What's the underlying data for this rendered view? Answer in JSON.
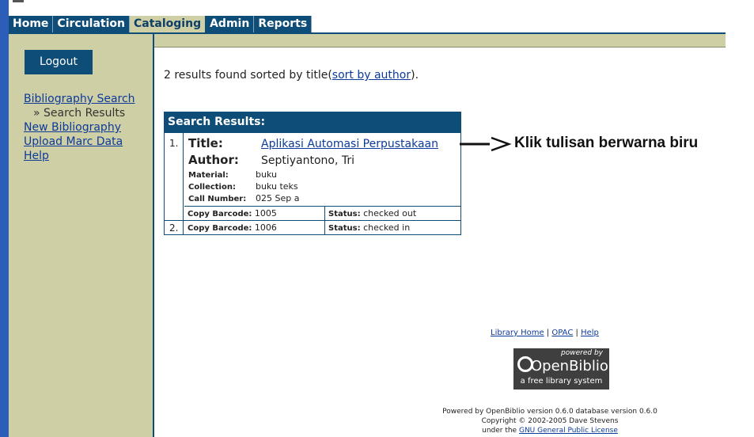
{
  "tabs": [
    "Home",
    "Circulation",
    "Cataloging",
    "Admin",
    "Reports"
  ],
  "active_tab": "Cataloging",
  "sidebar": {
    "logout_label": "Logout",
    "items": [
      {
        "label": "Bibliography Search"
      },
      {
        "label": "» Search Results"
      },
      {
        "label": "New Bibliography"
      },
      {
        "label": "Upload Marc Data"
      },
      {
        "label": "Help"
      }
    ]
  },
  "summary": {
    "text": "2 results found sorted by title(",
    "link": "sort by author",
    "end": ")."
  },
  "results": {
    "heading": "Search Results:",
    "items": [
      {
        "number": "1.",
        "title_label": "Title:",
        "title": "Aplikasi Automasi Perpustakaan",
        "author_label": "Author:",
        "author": "Septiyantono, Tri",
        "material_label": "Material:",
        "material": "buku",
        "collection_label": "Collection:",
        "collection": "buku teks",
        "call_label": "Call Number:",
        "call": "025 Sep a",
        "copy_label": "Copy Barcode:",
        "copy": "1005",
        "status_label": "Status:",
        "status": "checked out"
      },
      {
        "number": "2.",
        "copy_label": "Copy Barcode:",
        "copy": "1006",
        "status_label": "Status:",
        "status": "checked in"
      }
    ]
  },
  "annotation": "Klik tulisan berwarna biru",
  "footer": {
    "links": [
      "Library Home",
      "OPAC",
      "Help"
    ],
    "logo_powered": "powered by",
    "logo_name": "OpenBiblio",
    "logo_tag": "a free library system",
    "line1": "Powered by OpenBiblio version 0.6.0 database version 0.6.0",
    "line2": "Copyright © 2002-2005 Dave Stevens",
    "line3_pre": "under the ",
    "line3_link": "GNU General Public License"
  }
}
